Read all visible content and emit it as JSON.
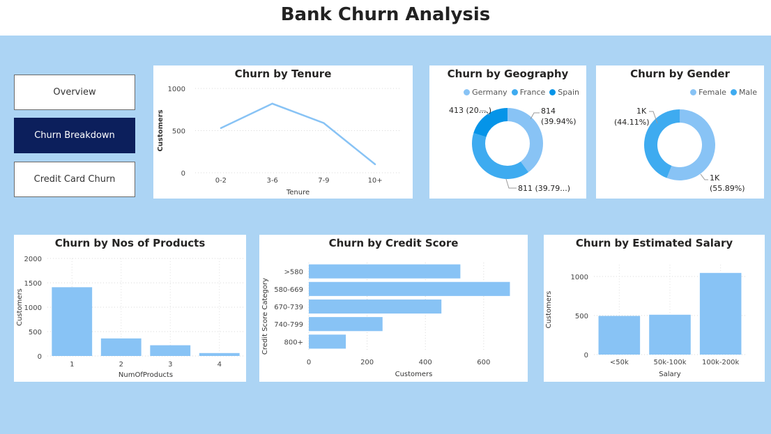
{
  "header": {
    "title": "Bank Churn Analysis"
  },
  "nav": {
    "overview": "Overview",
    "churn_breakdown": "Churn Breakdown",
    "credit_card": "Credit Card Churn"
  },
  "colors": {
    "bar": "#88c3f5",
    "dark": "#0c1f5c",
    "germany": "#88c3f5",
    "france": "#3eabf0",
    "spain": "#0594e8",
    "female": "#88c3f5",
    "male": "#3eabf0"
  },
  "tenure": {
    "title": "Churn by Tenure",
    "chart_data": {
      "type": "line",
      "categories": [
        "0-2",
        "3-6",
        "7-9",
        "10+"
      ],
      "values": [
        530,
        820,
        590,
        100
      ],
      "xlabel": "Tenure",
      "ylabel": "Customers",
      "yticks": [
        "0",
        "500",
        "1000"
      ],
      "ylim": [
        0,
        1000
      ]
    }
  },
  "geography": {
    "title": "Churn by Geography",
    "legend": [
      "Germany",
      "France",
      "Spain"
    ],
    "labels": {
      "germany_value": "814",
      "germany_pct": "(39.94%)",
      "france": "811 (39.79...)",
      "spain": "413 (20....)"
    },
    "chart_data": {
      "type": "pie",
      "categories": [
        "Germany",
        "France",
        "Spain"
      ],
      "values": [
        814,
        811,
        413
      ]
    }
  },
  "gender": {
    "title": "Churn by Gender",
    "legend": [
      "Female",
      "Male"
    ],
    "labels": {
      "female_value": "1K",
      "female_pct": "(55.89%)",
      "male_value": "1K",
      "male_pct": "(44.11%)"
    },
    "chart_data": {
      "type": "pie",
      "categories": [
        "Female",
        "Male"
      ],
      "values": [
        55.89,
        44.11
      ]
    }
  },
  "products": {
    "title": "Churn by Nos of Products",
    "chart_data": {
      "type": "bar",
      "categories": [
        "1",
        "2",
        "3",
        "4"
      ],
      "values": [
        1410,
        360,
        220,
        60
      ],
      "xlabel": "NumOfProducts",
      "ylabel": "Customers",
      "yticks": [
        "0",
        "500",
        "1000",
        "1500",
        "2000"
      ],
      "ylim": [
        0,
        2000
      ]
    }
  },
  "credit": {
    "title": "Churn by Credit Score",
    "chart_data": {
      "type": "bar",
      "orientation": "horizontal",
      "categories": [
        ">580",
        "580-669",
        "670-739",
        "740-799",
        "800+"
      ],
      "values": [
        520,
        690,
        455,
        253,
        127
      ],
      "xlabel": "Customers",
      "ylabel": "Credit Score Category",
      "xticks": [
        "0",
        "200",
        "400",
        "600"
      ],
      "xlim": [
        0,
        720
      ]
    }
  },
  "salary": {
    "title": "Churn by Estimated Salary",
    "chart_data": {
      "type": "bar",
      "categories": [
        "<50k",
        "50k-100k",
        "100k-200k"
      ],
      "values": [
        495,
        510,
        1045
      ],
      "xlabel": "Salary",
      "ylabel": "Customers",
      "yticks": [
        "0",
        "500",
        "1000"
      ],
      "ylim": [
        0,
        1150
      ]
    }
  }
}
